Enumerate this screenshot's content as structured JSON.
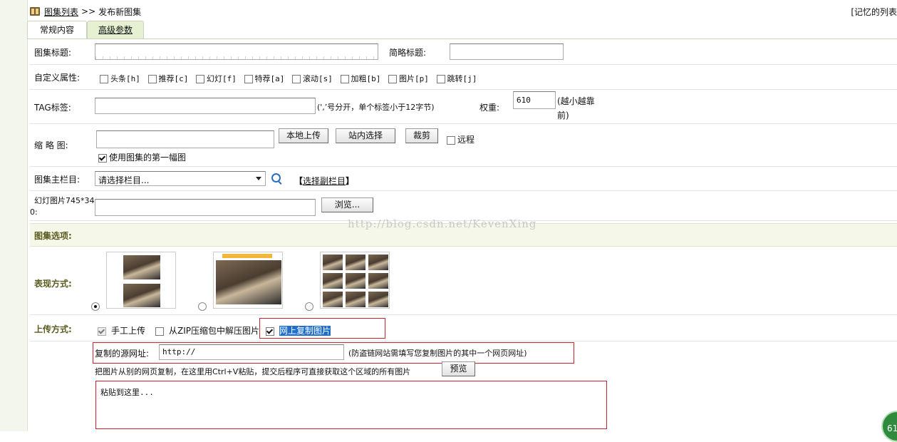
{
  "breadcrumb": {
    "list_link": "图集列表",
    "separator": ">>",
    "current": "发布新图集"
  },
  "top_right_link": "[记忆的列表",
  "tabs": [
    {
      "label": "常规内容"
    },
    {
      "label": "高级参数"
    }
  ],
  "fields": {
    "title_label": "图集标题:",
    "short_title_label": "简略标题:",
    "custom_attr_label": "自定义属性:",
    "attrs": [
      "头条[h]",
      "推荐[c]",
      "幻灯[f]",
      "特荐[a]",
      "滚动[s]",
      "加粗[b]",
      "图片[p]",
      "跳转[j]"
    ],
    "tag_label": "TAG标签:",
    "tag_hint": "(',’号分开，单个标签小于12字节)",
    "weight_label": "权重:",
    "weight_value": "610",
    "weight_hint_1": "(越小越靠",
    "weight_hint_2": "前)",
    "thumb_label": "缩 略 图:",
    "local_upload": "本地上传",
    "site_select": "站内选择",
    "crop": "裁剪",
    "remote": "远程",
    "use_first": "使用图集的第一幅图",
    "column_label": "图集主栏目:",
    "column_select": "请选择栏目...",
    "sub_column_open": "【",
    "sub_column_link": "选择副栏目",
    "sub_column_close": "】",
    "slide_label_1": "幻灯图片745*34",
    "slide_label_2": "0:",
    "browse": "浏览..."
  },
  "section": {
    "options_label": "图集选项:"
  },
  "display": {
    "label": "表现方式:",
    "selected": 0
  },
  "upload": {
    "label": "上传方式:",
    "manual": "手工上传",
    "zip": "从ZIP压缩包中解压图片",
    "web": "网上复制图片",
    "source_label": "复制的源网址:",
    "source_value": "http://",
    "source_hint": "(防盗链网站需填写您复制图片的其中一个网页网址)",
    "instruction": "把图片从别的网页复制，在这里用Ctrl+V粘贴，提交后程序可直接获取这个区域的所有图片",
    "preview": "预览",
    "paste_placeholder": "粘贴到这里..."
  },
  "watermark": "http://blog.csdn.net/KevenXing",
  "badge": "61",
  "colors": {
    "highlight": "#1f6fd1",
    "red_outline": "#c9252b",
    "tab_active": "#e5f1d2",
    "section_bg": "#f5f8e8"
  }
}
